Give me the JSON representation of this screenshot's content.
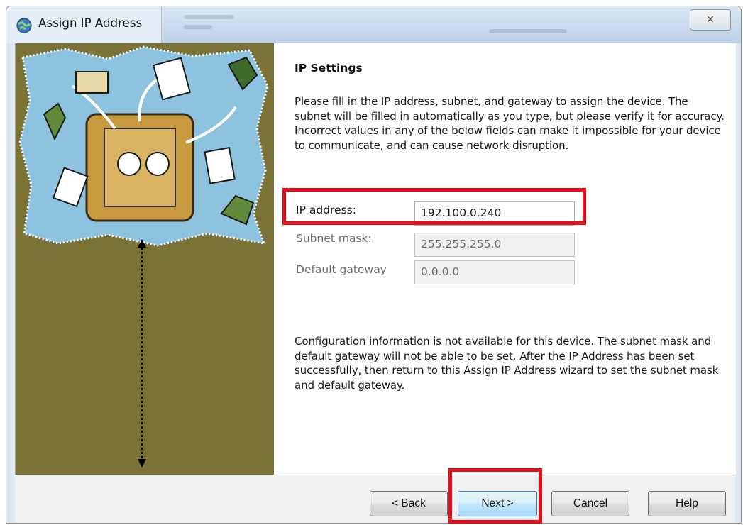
{
  "window": {
    "title": "Assign IP Address",
    "close_glyph": "✕"
  },
  "page": {
    "heading": "IP Settings",
    "description": "Please fill in the IP address, subnet, and gateway to assign the device. The subnet will be filled in automatically as you type, but please verify it for accuracy.  Incorrect values in any of the below fields can make it impossible for your device to communicate, and can cause network disruption.",
    "fields": [
      {
        "label": "IP address:",
        "value": "192.100.0.240",
        "enabled": true
      },
      {
        "label": "Subnet mask:",
        "value": "255.255.255.0",
        "enabled": false
      },
      {
        "label": "Default gateway",
        "value": "0.0.0.0",
        "enabled": false
      }
    ],
    "note": "Configuration information is not available for this device.  The subnet mask and default gateway will not be able to be set.  After the IP Address has been set successfully, then return to this Assign IP Address wizard to set the subnet mask and default gateway."
  },
  "buttons": {
    "back": "< Back",
    "next": "Next >",
    "cancel": "Cancel",
    "help": "Help"
  },
  "colors": {
    "side_panel": "#7a7237",
    "highlight": "#e3101a",
    "illustration_blue": "#8ec3e0"
  },
  "icons": {
    "title": "globe-network-icon",
    "close": "close-icon",
    "arrow": "vertical-double-arrow-icon"
  }
}
